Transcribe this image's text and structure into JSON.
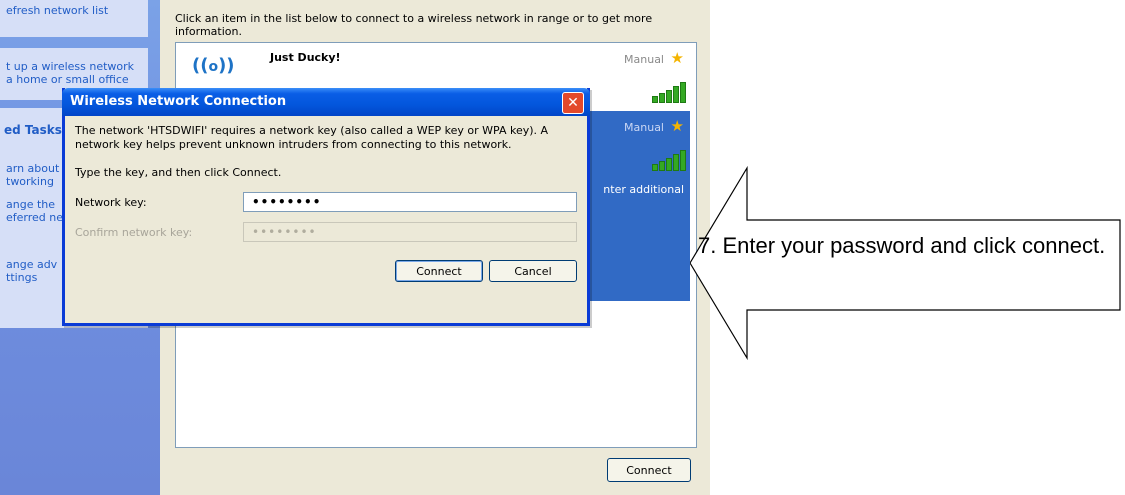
{
  "taskpane": {
    "items": [
      {
        "label": "efresh network list"
      },
      {
        "label": "t up a wireless network"
      },
      {
        "label": "a home or small office"
      }
    ],
    "related_tasks_header": "ed Tasks",
    "related_items": [
      {
        "label": "arn about"
      },
      {
        "label": "tworking"
      },
      {
        "label": "ange the"
      },
      {
        "label": "eferred ne"
      },
      {
        "label": "ange adv"
      },
      {
        "label": "ttings"
      }
    ]
  },
  "main": {
    "info_text": "Click an item in the list below to connect to a wireless network in range or to get more information.",
    "networks": [
      {
        "name": "Just Ducky!",
        "mode": "Manual",
        "signal_bars": 5
      },
      {
        "name": "",
        "mode": "Manual",
        "signal_bars": 5,
        "extra_text": "nter additional"
      }
    ],
    "connect_label": "Connect"
  },
  "dialog": {
    "title": "Wireless Network Connection",
    "close_glyph": "✕",
    "message": "The network 'HTSDWIFI' requires a network key (also called a WEP key or WPA key). A network key helps prevent unknown intruders from connecting to this network.",
    "instruction": "Type the key, and then click Connect.",
    "network_key_label": "Network key:",
    "network_key_value": "••••••••",
    "confirm_key_label": "Confirm network key:",
    "confirm_key_value": "••••••••",
    "connect_label": "Connect",
    "cancel_label": "Cancel"
  },
  "annotation": {
    "text": "7. Enter your password and click connect."
  },
  "colors": {
    "taskpane_blue": "#7ba2e7",
    "selection_blue": "#316ac5",
    "titlebar_blue": "#0356dc",
    "window_face": "#ece9d8",
    "close_red": "#e3492b",
    "signal_green": "#34a923",
    "star_gold": "#f4b400"
  },
  "icons": {
    "network": "wireless-antenna-icon",
    "favorite": "star-icon",
    "signal": "signal-strength-icon",
    "close": "close-icon"
  }
}
